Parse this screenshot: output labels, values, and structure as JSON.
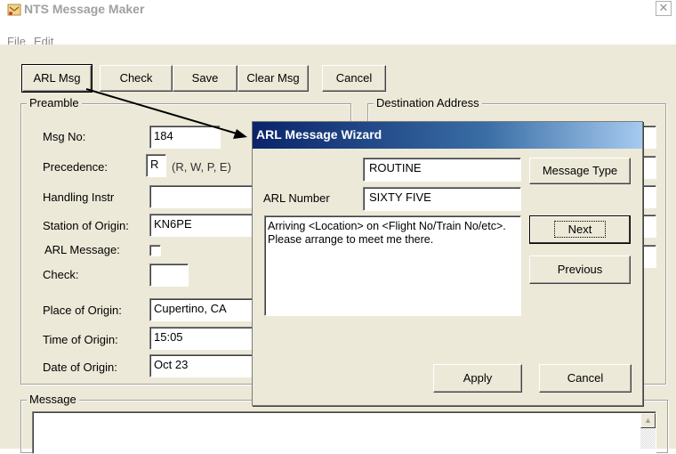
{
  "window": {
    "title": "NTS Message Maker",
    "close_glyph": "✕"
  },
  "menu": {
    "items": [
      "File",
      "Edit"
    ]
  },
  "toolbar": {
    "arl_msg": "ARL Msg",
    "check": "Check",
    "save": "Save",
    "clear_msg": "Clear Msg",
    "cancel": "Cancel"
  },
  "preamble": {
    "group_label": "Preamble",
    "msg_no_label": "Msg No:",
    "msg_no_value": "184",
    "precedence_label": "Precedence:",
    "precedence_value": "R",
    "precedence_hint": "(R, W, P, E)",
    "handling_label": "Handling Instr",
    "handling_value": "",
    "station_label": "Station of Origin:",
    "station_value": "KN6PE",
    "arl_message_label": "ARL Message:",
    "arl_message_checked": false,
    "check_label": "Check:",
    "check_value": "",
    "place_label": "Place of Origin:",
    "place_value": "Cupertino, CA",
    "time_label": "Time of Origin:",
    "time_value": "15:05",
    "date_label": "Date of Origin:",
    "date_value": "Oct 23"
  },
  "destination": {
    "group_label": "Destination Address"
  },
  "message": {
    "group_label": "Message",
    "body": ""
  },
  "dialog": {
    "title": "ARL Message Wizard",
    "type_value": "ROUTINE",
    "arl_number_label": "ARL Number",
    "arl_number_value": "SIXTY FIVE",
    "message_text": "Arriving <Location> on <Flight No/Train No/etc>. Please arrange to meet me there.",
    "message_type_button": "Message Type",
    "next_button": "Next",
    "previous_button": "Previous",
    "apply_button": "Apply",
    "cancel_button": "Cancel"
  },
  "colors": {
    "face": "#ece9d8",
    "title_gradient_start": "#0a246a",
    "title_gradient_end": "#a6caf0"
  }
}
